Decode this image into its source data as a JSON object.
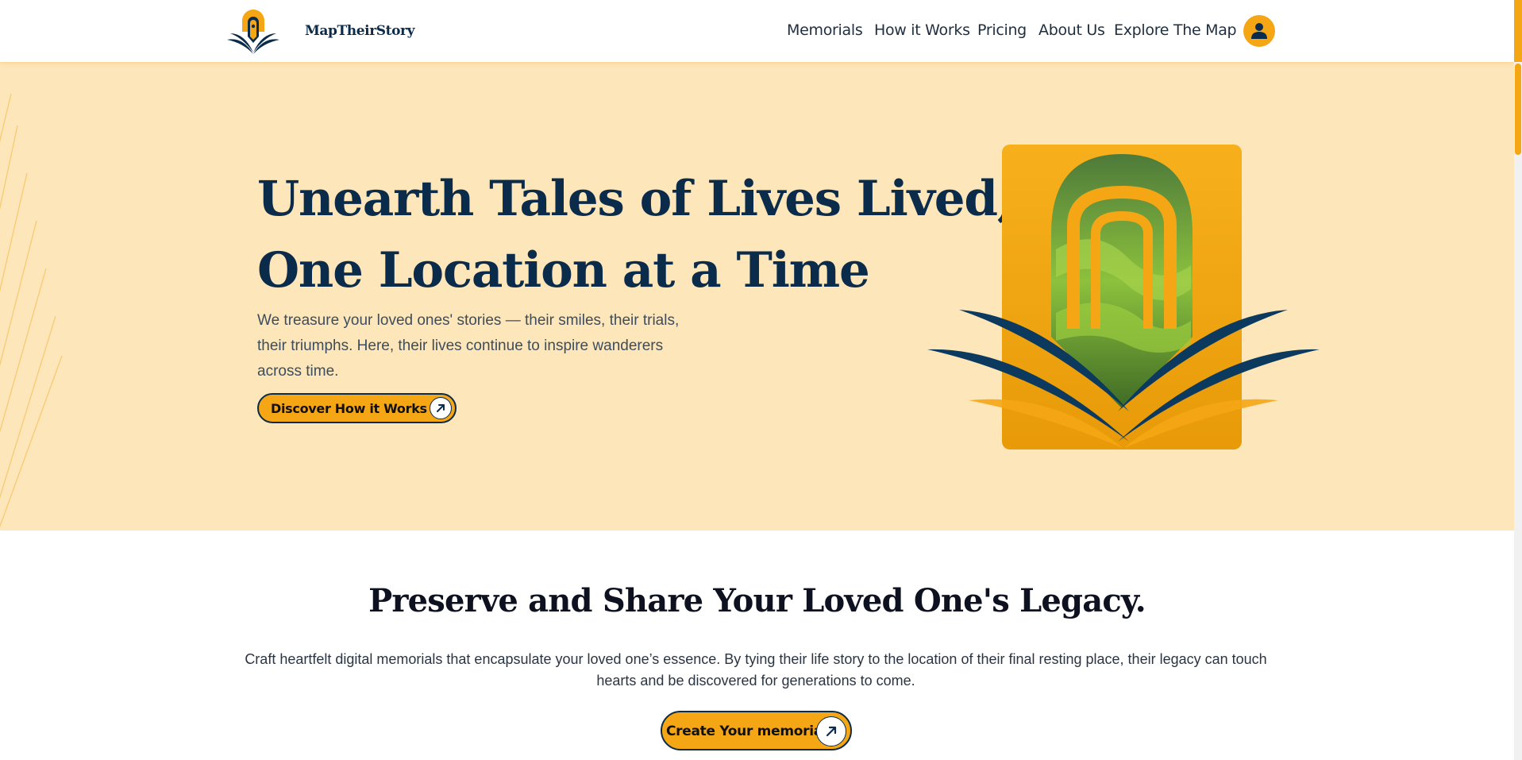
{
  "brand": {
    "name": "MapTheirStory",
    "primary_color": "#0b2b4b",
    "accent_color": "#f5a614",
    "hero_bg": "#fde6ba"
  },
  "nav": {
    "items": [
      {
        "label": "Memorials"
      },
      {
        "label": "How it Works"
      },
      {
        "label": "Pricing"
      },
      {
        "label": "About Us"
      },
      {
        "label": "Explore The Map"
      }
    ],
    "account_icon": "user-icon"
  },
  "hero": {
    "title_line1": "Unearth Tales of Lives Lived,",
    "title_line2": "One Location at a Time",
    "description": "We treasure your loved ones' stories — their smiles, their trials, their triumphs. Here, their lives continue to inspire wanderers across time.",
    "cta_label": "Discover How it Works",
    "cta_icon": "arrow-up-right-icon",
    "illustration": "landscape-book-emblem"
  },
  "legacy": {
    "title": "Preserve and Share Your Loved One's Legacy.",
    "description": "Craft heartfelt digital memorials that encapsulate your loved one’s essence. By tying their life story to the location of their final resting place, their legacy can touch hearts and be discovered for generations to come.",
    "cta_label": "Create Your memorial",
    "cta_icon": "arrow-up-right-icon"
  }
}
